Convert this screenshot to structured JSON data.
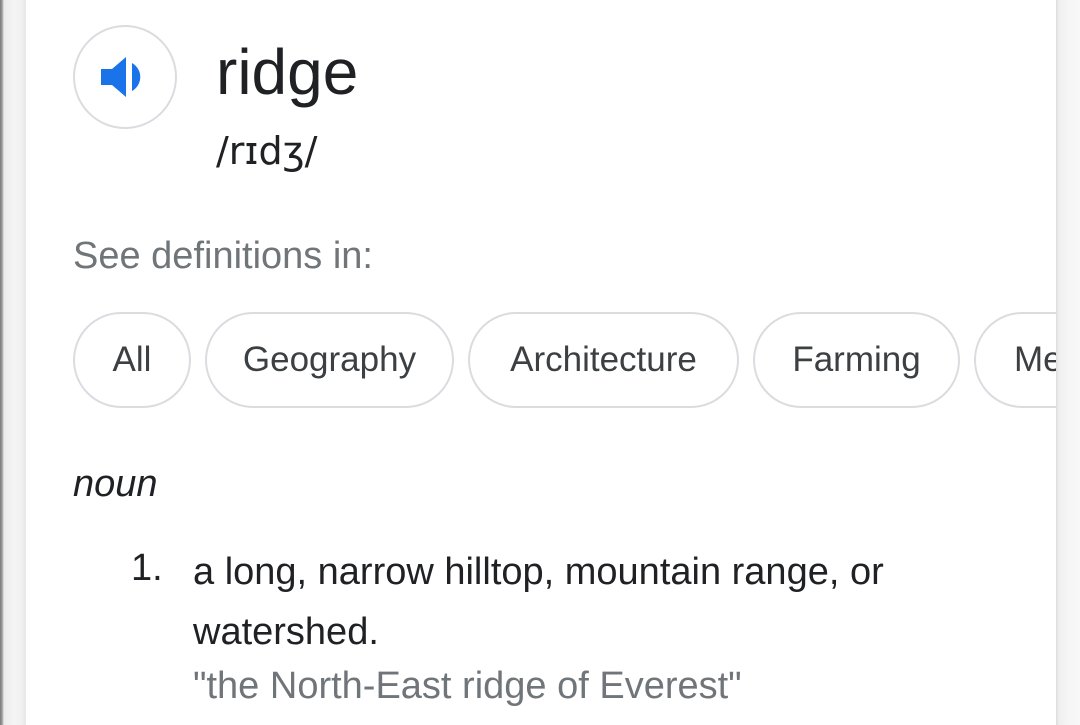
{
  "entry": {
    "word": "ridge",
    "phonetic": "/rɪdʒ/",
    "audio_icon": "speaker-volume-icon"
  },
  "see_definitions": {
    "label": "See definitions in:",
    "chips": [
      "All",
      "Geography",
      "Architecture",
      "Farming",
      "Me"
    ]
  },
  "part_of_speech": "noun",
  "definitions": [
    {
      "number": "1.",
      "text": "a long, narrow hilltop, mountain range, or watershed.",
      "example": "\"the North-East ridge of Everest\""
    }
  ],
  "colors": {
    "accent_blue": "#1a73e8",
    "text_primary": "#202124",
    "text_secondary": "#70757a",
    "chip_border": "#dadce0"
  }
}
